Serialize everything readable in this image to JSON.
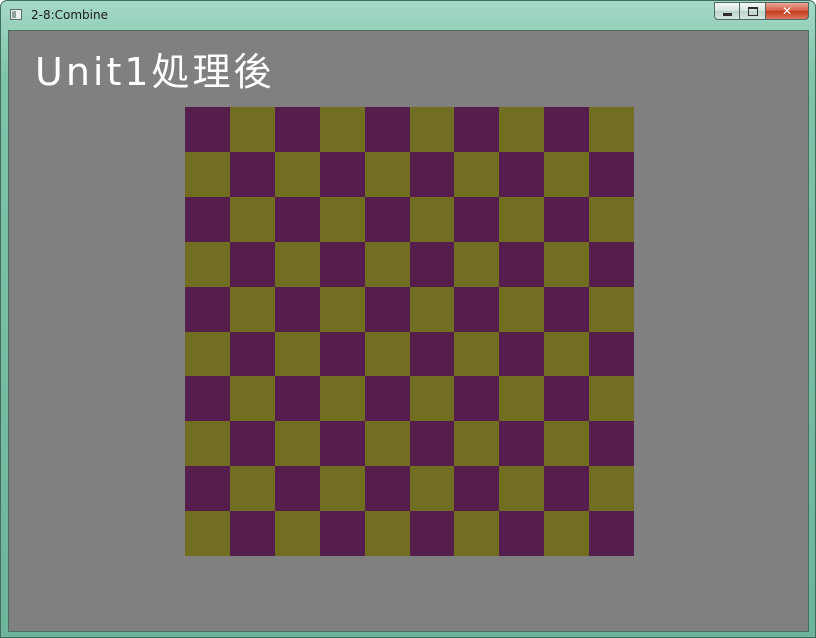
{
  "window": {
    "title": "2-8:Combine",
    "caption": {
      "minimize_icon": "minimize-icon",
      "maximize_icon": "maximize-icon",
      "close_label": "✕"
    }
  },
  "viewport": {
    "background": "#808080",
    "label": "Unit1処理後",
    "checkerboard": {
      "rows": 10,
      "cols": 10,
      "color_a": "#561e4c",
      "color_b": "#716e22",
      "first_cell": "color_a"
    }
  }
}
